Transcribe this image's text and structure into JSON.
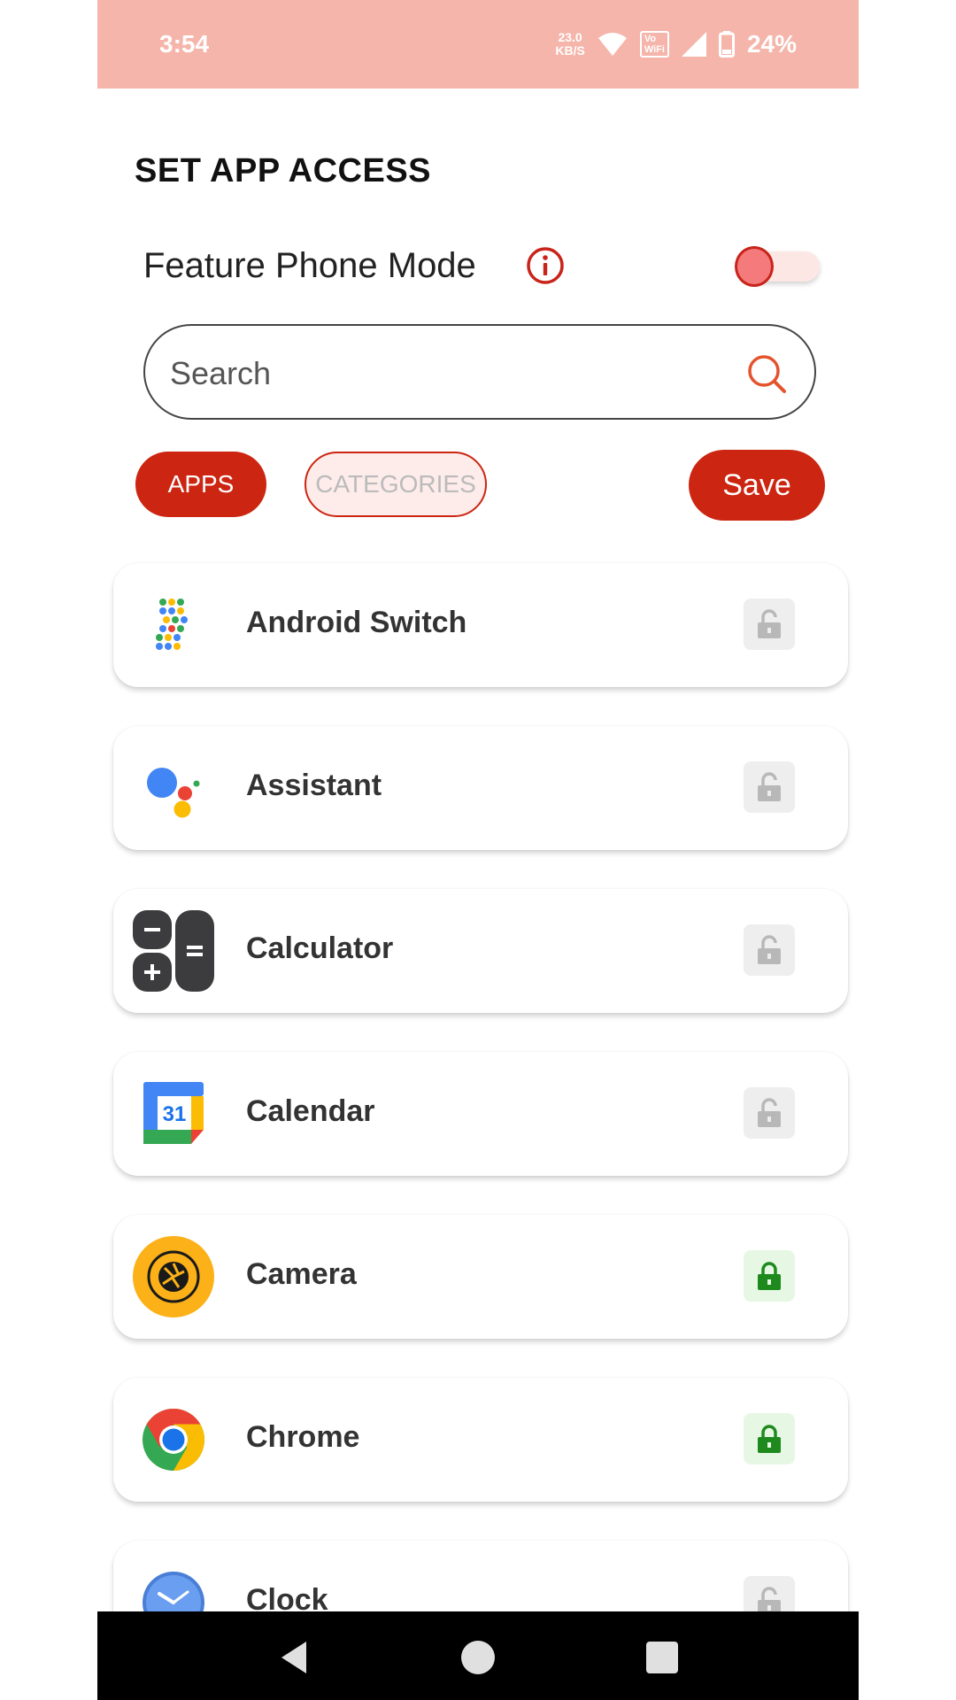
{
  "status_bar": {
    "time": "3:54",
    "net_speed_value": "23.0",
    "net_speed_unit": "KB/S",
    "vowifi_top": "Vo",
    "vowifi_bottom": "WiFi",
    "battery": "24%"
  },
  "header": {
    "title": "SET APP ACCESS"
  },
  "feature_phone": {
    "label": "Feature Phone Mode"
  },
  "search": {
    "placeholder": "Search"
  },
  "tabs": {
    "apps_label": "APPS",
    "categories_label": "CATEGORIES"
  },
  "actions": {
    "save_label": "Save"
  },
  "apps": [
    {
      "name": "Android Switch",
      "icon": "android-switch-icon",
      "locked": false
    },
    {
      "name": "Assistant",
      "icon": "assistant-icon",
      "locked": false
    },
    {
      "name": "Calculator",
      "icon": "calculator-icon",
      "locked": false
    },
    {
      "name": "Calendar",
      "icon": "calendar-icon",
      "calendar_day": "31",
      "locked": false
    },
    {
      "name": "Camera",
      "icon": "camera-icon",
      "locked": true
    },
    {
      "name": "Chrome",
      "icon": "chrome-icon",
      "locked": true
    },
    {
      "name": "Clock",
      "icon": "clock-icon",
      "locked": false
    }
  ],
  "colors": {
    "accent": "#cc2511",
    "status_bar": "#f5b5aa",
    "locked_green": "#1e8a1e",
    "unlocked_gray": "#b8b8b8"
  }
}
